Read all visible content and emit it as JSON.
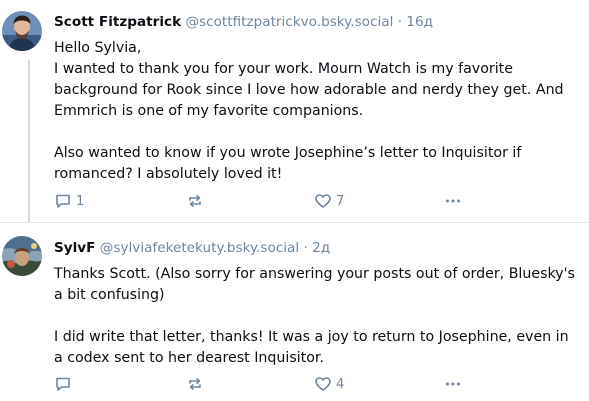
{
  "posts": [
    {
      "author_name": "Scott Fitzpatrick",
      "handle": "@scottfitzpatrickvo.bsky.social",
      "separator": "·",
      "age": "16д",
      "paragraphs": [
        "Hello Sylvia,\nI wanted to thank you for your work. Mourn Watch is my favorite background for Rook since I love how adorable and nerdy they get. And Emmrich is one of my favorite companions.",
        "Also wanted to know if you wrote Josephine’s letter to Inquisitor if romanced? I absolutely loved it!"
      ],
      "reply_count": "1",
      "repost_count": "",
      "like_count": "7"
    },
    {
      "author_name": "SylvF",
      "handle": "@sylviafeketekuty.bsky.social",
      "separator": "·",
      "age": "2д",
      "paragraphs": [
        "Thanks Scott. (Also sorry for answering your posts out of order, Bluesky's a bit confusing)",
        "I did write that letter, thanks! It was a joy to return to Josephine, even in a codex sent to her dearest Inquisitor."
      ],
      "reply_count": "",
      "repost_count": "",
      "like_count": "4"
    }
  ],
  "icons": {
    "reply": "speech-bubble-icon",
    "repost": "repost-arrows-icon",
    "like": "heart-outline-icon",
    "more": "more-dots-icon"
  },
  "colors": {
    "text": "#0b0f14",
    "muted": "#6f869f",
    "thread_line": "#d4dbe2",
    "divider": "#e2e7ee"
  }
}
